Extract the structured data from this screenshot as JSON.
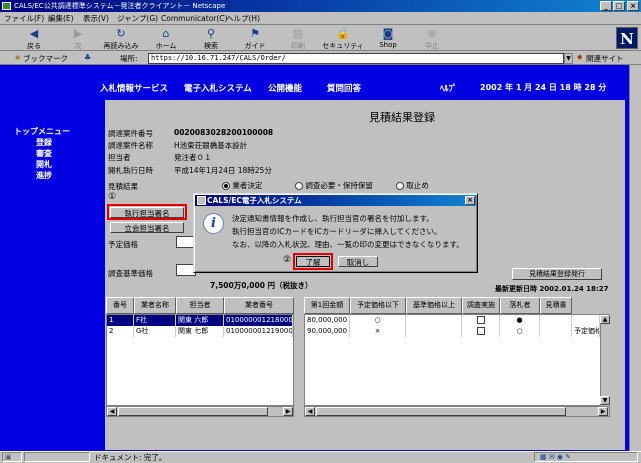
{
  "window": {
    "title": "CALS/EC公共調達標準システム－発注者クライアント－ Netscape",
    "buttons": {
      "minimize": "_",
      "maximize": "□",
      "close": "×"
    }
  },
  "menubar": [
    "ファイル(F)",
    "編集(E)",
    "表示(V)",
    "ジャンプ(G)",
    "Communicator(C)",
    "ヘルプ(H)"
  ],
  "toolbar": {
    "buttons": [
      {
        "label": "戻る",
        "icon": "back-arrow-icon",
        "enabled": true
      },
      {
        "label": "次",
        "icon": "forward-arrow-icon",
        "enabled": false
      },
      {
        "label": "再読み込み",
        "icon": "reload-icon",
        "enabled": true
      },
      {
        "label": "ホーム",
        "icon": "home-icon",
        "enabled": true
      },
      {
        "label": "検索",
        "icon": "search-icon",
        "enabled": true
      },
      {
        "label": "ガイド",
        "icon": "guide-icon",
        "enabled": true
      },
      {
        "label": "印刷",
        "icon": "print-icon",
        "enabled": false
      },
      {
        "label": "セキュリティ",
        "icon": "security-lock-icon",
        "enabled": true
      },
      {
        "label": "Shop",
        "icon": "shop-icon",
        "enabled": true
      },
      {
        "label": "中止",
        "icon": "stop-icon",
        "enabled": false
      }
    ],
    "logo": "N"
  },
  "locationbar": {
    "bookmarks_label": "ブックマーク",
    "location_label": "場所:",
    "url": "https://10.16.71.247/CALS/Order/",
    "related_label": "関連サイト"
  },
  "nav": {
    "items": [
      "入札情報サービス",
      "電子入札システム",
      "公開機能",
      "質問回答",
      "ﾍﾙﾌﾟ"
    ],
    "datetime": "2002 年  1 月 24 日   18 時 28 分"
  },
  "sidebar": {
    "heading": "トップメニュー",
    "items": [
      "登録",
      "審査",
      "開札",
      "進捗"
    ]
  },
  "main": {
    "title": "見積結果登録",
    "fields": [
      {
        "label": "調達案件番号",
        "value": "0020083028200100008"
      },
      {
        "label": "調達案件名称",
        "value": "H池東荘銀橋基本設計"
      },
      {
        "label": "担当者",
        "value": "発注者０１"
      },
      {
        "label": "開札執行日時",
        "value": "平成14年1月24日 18時25分"
      }
    ],
    "result_label": "見積結果",
    "result_options": [
      "業者決定",
      "調査必要・保持保留",
      "取止め"
    ],
    "result_selected": 0,
    "step1": "①",
    "step2": "②",
    "btn_executive_sign": "執行担当署名",
    "btn_witness_sign": "立会担当署名",
    "label_estimated_price": "予定価格",
    "label_survey_base_price": "調査基準価格",
    "amount_text": "7,500万0,000  円（税抜き）",
    "btn_issue_result": "見積結果登録発行",
    "last_updated": "最新更新日時 2002.01.24 18:27",
    "table": {
      "left_headers": [
        "番号",
        "業者名称",
        "担当者",
        "業者番号"
      ],
      "right_headers": [
        "第1回金額",
        "予定価格以下",
        "基準価格以上",
        "調査実施",
        "落札者",
        "見積書"
      ],
      "rows": [
        {
          "no": "1",
          "company": "F社",
          "person": "関東 六郎",
          "code": "010000001218000100",
          "amount": "80,000,000",
          "below_est": "○",
          "above_base": "",
          "survey": "",
          "winner": "●",
          "quote": "",
          "note": ""
        },
        {
          "no": "2",
          "company": "G社",
          "person": "関東 七郎",
          "code": "010000001219000100",
          "amount": "90,000,000",
          "below_est": "×",
          "above_base": "",
          "survey": "",
          "winner": "○",
          "quote": "",
          "note": "予定価格"
        }
      ]
    }
  },
  "dialog": {
    "title": "CALS/EC電子入札システム",
    "messages": [
      "決定通知書情報を作成し、執行担当官の署名を付加します。",
      "執行担当官のICカードをICカードリーダに挿入してください。",
      "なお、以降の入札状況、理由、一覧の印の変更はできなくなります。"
    ],
    "ok_label": "了解",
    "cancel_label": "取消し"
  },
  "statusbar": {
    "text": "ドキュメント: 完了。"
  }
}
